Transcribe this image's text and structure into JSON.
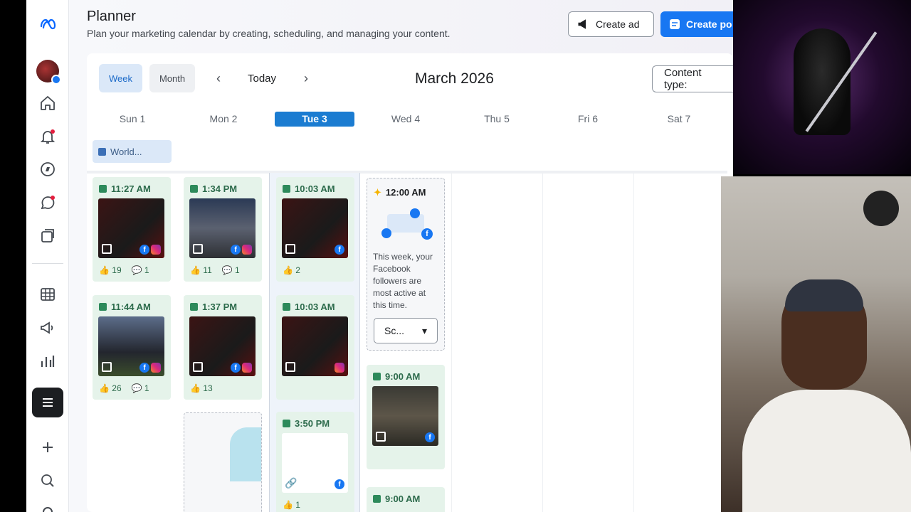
{
  "rail": {
    "items": [
      "meta-logo",
      "account-avatar",
      "home",
      "notifications",
      "explore",
      "messages",
      "content",
      "all-tools-grid",
      "ads",
      "insights",
      "menu",
      "add",
      "search",
      "settings"
    ]
  },
  "header": {
    "title": "Planner",
    "subtitle": "Plan your marketing calendar by creating, scheduling, and managing your content.",
    "create_ad": "Create ad",
    "create_post": "Create po"
  },
  "toolbar": {
    "week": "Week",
    "month_tab": "Month",
    "today": "Today",
    "month_label": "March 2026",
    "content_type": "Content type:"
  },
  "days": [
    "Sun 1",
    "Mon 2",
    "Tue 3",
    "Wed 4",
    "Thu 5",
    "Fri 6",
    "Sat 7"
  ],
  "event_chip": "World...",
  "posts": [
    {
      "time": "11:27 AM",
      "likes": "19",
      "comments": "1"
    },
    {
      "time": "1:34 PM",
      "likes": "11",
      "comments": "1"
    },
    {
      "time": "10:03 AM",
      "likes": "2",
      "comments": ""
    },
    {
      "time": "11:44 AM",
      "likes": "26",
      "comments": "1"
    },
    {
      "time": "1:37 PM",
      "likes": "13",
      "comments": ""
    },
    {
      "time": "10:03 AM",
      "likes": "",
      "comments": ""
    },
    {
      "time": "3:50 PM",
      "likes": "1",
      "comments": ""
    },
    {
      "time": "9:00 AM",
      "likes": "",
      "comments": ""
    },
    {
      "time": "9:00 AM",
      "likes": "",
      "comments": ""
    }
  ],
  "suggestion": {
    "time": "12:00 AM",
    "text": "This week, your Facebook followers are most active at this time.",
    "button": "Sc..."
  },
  "colors": {
    "accent": "#1877f2",
    "today_bg": "#1b7cd1",
    "post_bg": "#e5f3ea"
  }
}
